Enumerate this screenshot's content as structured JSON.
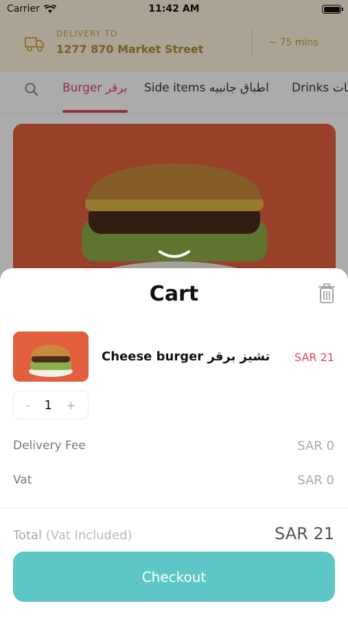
{
  "status_bar": {
    "carrier": "Carrier",
    "time": "11:42 AM"
  },
  "delivery": {
    "label": "DELIVERY TO",
    "address": "1277 870 Market Street",
    "eta": "~ 75 mins"
  },
  "tabs": [
    {
      "label": "Burger برقر",
      "active": true
    },
    {
      "label": "Side items اطباق جانبيه",
      "active": false
    },
    {
      "label": "Drinks مشروبات",
      "active": false
    }
  ],
  "cart": {
    "title": "Cart",
    "item": {
      "name": "Cheese burger تشيز برقر",
      "price": "SAR 21",
      "quantity": "1",
      "minus": "-",
      "plus": "+"
    },
    "delivery_fee": {
      "label": "Delivery Fee",
      "value": "SAR 0"
    },
    "vat": {
      "label": "Vat",
      "value": "SAR 0"
    },
    "total": {
      "label": "Total",
      "note": "(Vat Included)",
      "value": "SAR 21"
    },
    "checkout_label": "Checkout"
  },
  "colors": {
    "accent": "#e0435c",
    "checkout": "#5cc7c6",
    "header_bg": "#fff4dc"
  }
}
